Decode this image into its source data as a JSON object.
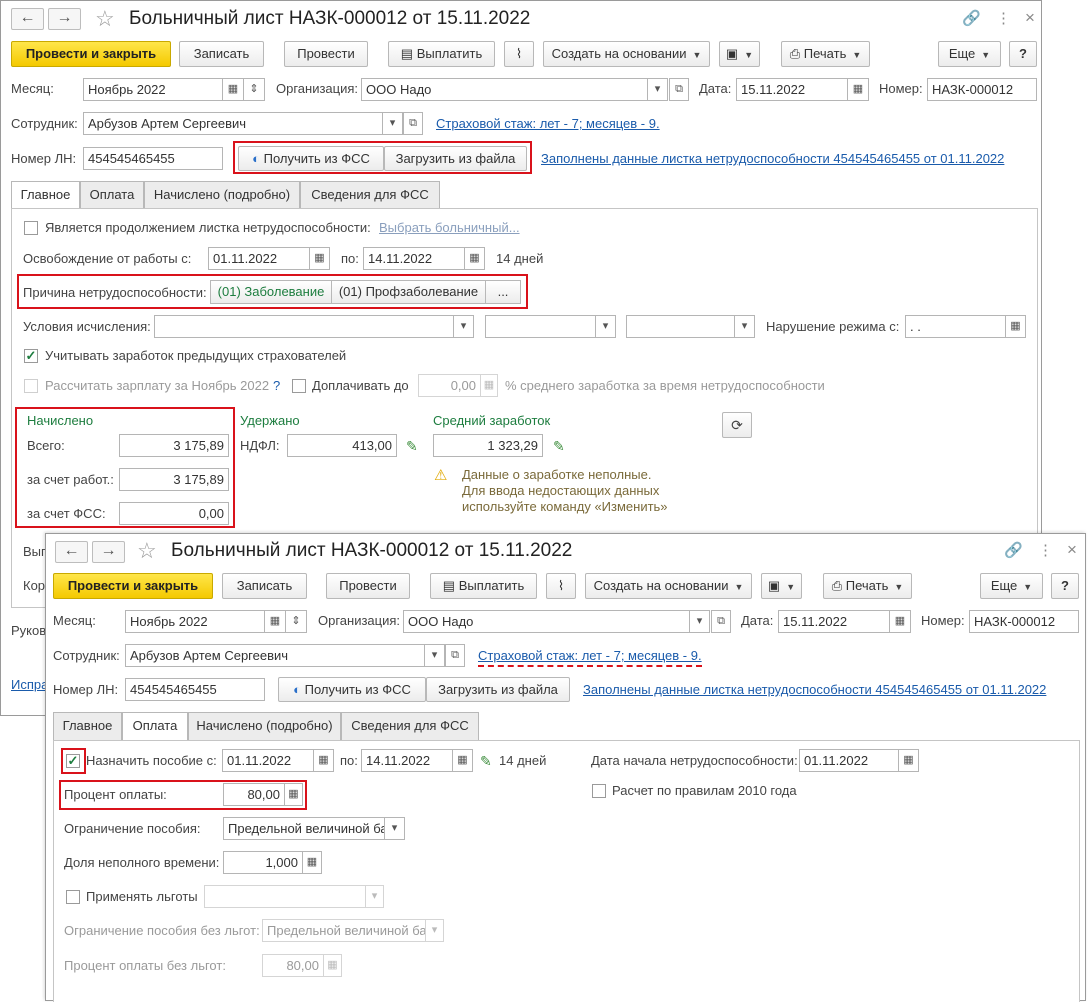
{
  "window1": {
    "title": "Больничный лист НАЗК-000012 от 15.11.2022",
    "toolbar": {
      "post_close": "Провести и закрыть",
      "write": "Записать",
      "post": "Провести",
      "pay": "Выплатить",
      "create_based": "Создать на основании",
      "print": "Печать",
      "more": "Еще",
      "help": "?"
    },
    "header": {
      "month_label": "Месяц:",
      "month_value": "Ноябрь 2022",
      "org_label": "Организация:",
      "org_value": "ООО Надо",
      "date_label": "Дата:",
      "date_value": "15.11.2022",
      "number_label": "Номер:",
      "number_value": "НАЗК-000012",
      "employee_label": "Сотрудник:",
      "employee_value": "Арбузов Артем Сергеевич",
      "insurance_link": "Страховой стаж: лет - 7; месяцев - 9.",
      "ln_label": "Номер ЛН:",
      "ln_value": "454545465455",
      "get_fss": "Получить из ФСС",
      "load_file": "Загрузить из файла",
      "filled_link": "Заполнены данные листка нетрудоспособности 454545465455 от 01.11.2022"
    },
    "tabs": [
      "Главное",
      "Оплата",
      "Начислено (подробно)",
      "Сведения для ФСС"
    ],
    "main": {
      "continuation_label": "Является продолжением листка нетрудоспособности:",
      "choose_link": "Выбрать больничный...",
      "release_label": "Освобождение от работы с:",
      "release_from": "01.11.2022",
      "to_label": "по:",
      "release_to": "14.11.2022",
      "days": "14 дней",
      "reason_label": "Причина нетрудоспособности:",
      "reason_sick": "(01) Заболевание",
      "reason_prof": "(01) Профзаболевание",
      "reason_more": "...",
      "conditions_label": "Условия исчисления:",
      "violation_label": "Нарушение режима с:",
      "violation_value": " .  .",
      "prev_insurers_label": "Учитывать заработок предыдущих страхователей",
      "calc_salary_label": "Рассчитать зарплату за Ноябрь 2022",
      "calc_help": "?",
      "topup_label": "Доплачивать до",
      "topup_value": "0,00",
      "topup_suffix": "% среднего заработка за время нетрудоспособности"
    },
    "accrued": {
      "title": "Начислено",
      "total_label": "Всего:",
      "total_value": "3 175,89",
      "employer_label": "за счет работ.:",
      "employer_value": "3 175,89",
      "fss_label": "за счет ФСС:",
      "fss_value": "0,00"
    },
    "withheld": {
      "title": "Удержано",
      "ndfl_label": "НДФЛ:",
      "ndfl_value": "413,00"
    },
    "avg": {
      "title": "Средний заработок",
      "value": "1 323,29",
      "warning_lines": [
        "Данные о заработке неполные.",
        "Для ввода недостающих данных",
        "используйте команду «Изменить»"
      ]
    },
    "bottom_partial": [
      "Вып",
      "Корр",
      "Руков",
      "Испра"
    ]
  },
  "window2": {
    "title": "Больничный лист НАЗК-000012 от 15.11.2022",
    "tabs": [
      "Главное",
      "Оплата",
      "Начислено (подробно)",
      "Сведения для ФСС"
    ],
    "payment": {
      "assign_label": "Назначить пособие с:",
      "assign_from": "01.11.2022",
      "to_label": "по:",
      "assign_to": "14.11.2022",
      "days": "14 дней",
      "start_date_label": "Дата начала нетрудоспособности:",
      "start_date_value": "01.11.2022",
      "percent_label": "Процент оплаты:",
      "percent_value": "80,00",
      "rules2010_label": "Расчет по правилам 2010 года",
      "limit_label": "Ограничение пособия:",
      "limit_value": "Предельной величиной ба",
      "part_time_label": "Доля неполного времени:",
      "part_time_value": "1,000",
      "benefits_label": "Применять льготы",
      "limit_nobenefit_label": "Ограничение пособия без льгот:",
      "limit_nobenefit_value": "Предельной величиной ба",
      "percent_nobenefit_label": "Процент оплаты без льгот:",
      "percent_nobenefit_value": "80,00"
    }
  },
  "icons": {
    "back": "←",
    "forward": "→",
    "star": "☆",
    "link": "🔗",
    "menu": "⋮",
    "close": "×",
    "calendar": "▦",
    "dropdown": "▾",
    "open": "⧉",
    "spin": "⇕",
    "pencil": "✎",
    "warning": "⚠",
    "refresh": "⟳",
    "attach": "📎",
    "print": "⎙",
    "check": "✓"
  },
  "colors": {
    "primary_button": "#f4c900",
    "highlight": "#d9121b",
    "link": "#1a5bab",
    "green_text": "#1d7d3f"
  }
}
